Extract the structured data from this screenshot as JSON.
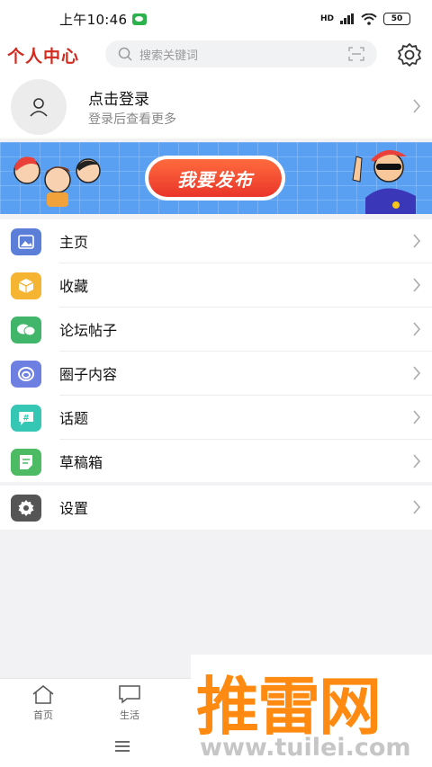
{
  "status_bar": {
    "time": "上午10:46",
    "signal": "HD",
    "battery": "50"
  },
  "header": {
    "title": "个人中心",
    "search_placeholder": "搜索关键词"
  },
  "login": {
    "title": "点击登录",
    "subtitle": "登录后查看更多"
  },
  "banner": {
    "button_label": "我要发布"
  },
  "menu": [
    {
      "label": "主页",
      "icon": "image-icon",
      "color": "#5b7fd9"
    },
    {
      "label": "收藏",
      "icon": "box-icon",
      "color": "#f5b431"
    },
    {
      "label": "论坛帖子",
      "icon": "chat-bubbles-icon",
      "color": "#41b66a"
    },
    {
      "label": "圈子内容",
      "icon": "circle-swirl-icon",
      "color": "#6d7fe0"
    },
    {
      "label": "话题",
      "icon": "hashtag-icon",
      "color": "#35c7b4"
    },
    {
      "label": "草稿箱",
      "icon": "draft-icon",
      "color": "#4cbb63"
    }
  ],
  "settings": {
    "label": "设置",
    "icon": "gear-icon",
    "color": "#555555"
  },
  "tabbar": [
    {
      "label": "首页",
      "icon": "home-icon"
    },
    {
      "label": "生活",
      "icon": "message-icon"
    }
  ],
  "watermark": {
    "text": "推雷网",
    "url": "www.tuilei.com"
  }
}
